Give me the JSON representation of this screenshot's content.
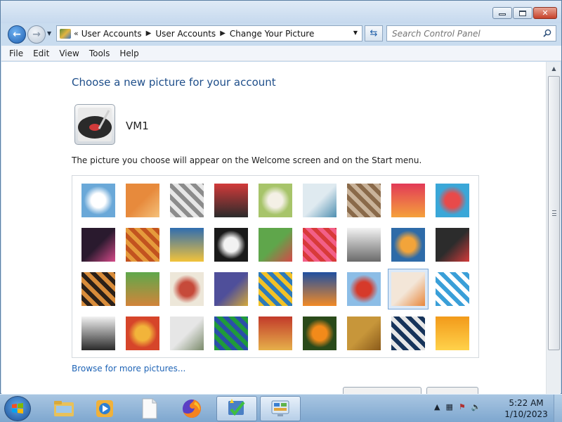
{
  "window": {
    "buttons": {
      "minimize": "minimize",
      "maximize": "maximize",
      "close": "✕"
    }
  },
  "nav": {
    "back_glyph": "←",
    "forward_glyph": "→",
    "breadcrumb_lead": "«",
    "breadcrumb": [
      "User Accounts",
      "User Accounts",
      "Change Your Picture"
    ],
    "search_placeholder": "Search Control Panel"
  },
  "menu": [
    "File",
    "Edit",
    "View",
    "Tools",
    "Help"
  ],
  "main": {
    "heading": "Choose a new picture for your account",
    "account_name": "VM1",
    "description": "The picture you choose will appear on the Welcome screen and on the Start menu.",
    "browse_link": "Browse for more pictures...",
    "selected_picture_index": 25,
    "pictures": [
      {
        "name": "roller-coaster",
        "colors": [
          "#6aa8d8",
          "#ffffff"
        ]
      },
      {
        "name": "starfish",
        "colors": [
          "#e78a3c",
          "#f5c27c"
        ]
      },
      {
        "name": "robot",
        "colors": [
          "#e7e7e7",
          "#8c8c8c"
        ]
      },
      {
        "name": "record-player",
        "colors": [
          "#d23a3a",
          "#2b2b2b"
        ]
      },
      {
        "name": "lucky-cat",
        "colors": [
          "#a7c46a",
          "#f4f0e6"
        ]
      },
      {
        "name": "gyroscope",
        "colors": [
          "#dfeaf0",
          "#4f8fb0"
        ]
      },
      {
        "name": "kitten",
        "colors": [
          "#c9b39a",
          "#8a6a4a"
        ]
      },
      {
        "name": "flower",
        "colors": [
          "#e23a57",
          "#f5a13c"
        ]
      },
      {
        "name": "pinwheel",
        "colors": [
          "#3aa7d8",
          "#e84a4a"
        ]
      },
      {
        "name": "bowling-ball",
        "colors": [
          "#2a1a2e",
          "#d64a8a"
        ]
      },
      {
        "name": "fabric",
        "colors": [
          "#c2531f",
          "#e59a3c"
        ]
      },
      {
        "name": "leaf",
        "colors": [
          "#2f6db0",
          "#f2c33a"
        ]
      },
      {
        "name": "dog",
        "colors": [
          "#1a1a1a",
          "#f2f2f2"
        ]
      },
      {
        "name": "crayons",
        "colors": [
          "#5fa64b",
          "#d64848"
        ]
      },
      {
        "name": "star",
        "colors": [
          "#f25f88",
          "#d83a3a"
        ]
      },
      {
        "name": "jacks",
        "colors": [
          "#f2f2f2",
          "#6a6a6a"
        ]
      },
      {
        "name": "stairs",
        "colors": [
          "#2e6ba8",
          "#f2a43a"
        ]
      },
      {
        "name": "paper-crane",
        "colors": [
          "#2c2c2c",
          "#d43a3a"
        ]
      },
      {
        "name": "guitar",
        "colors": [
          "#d88c3a",
          "#2b2018"
        ]
      },
      {
        "name": "pomeranian",
        "colors": [
          "#5fa84b",
          "#d2843a"
        ]
      },
      {
        "name": "toy-robot",
        "colors": [
          "#ede7d9",
          "#c64a3a"
        ]
      },
      {
        "name": "textile",
        "colors": [
          "#4f4f9a",
          "#d4a93a"
        ]
      },
      {
        "name": "sunflower",
        "colors": [
          "#f2c226",
          "#2e7ab8"
        ]
      },
      {
        "name": "fish",
        "colors": [
          "#1f4fa0",
          "#f28a26"
        ]
      },
      {
        "name": "balloon",
        "colors": [
          "#8cbde6",
          "#d63a2a"
        ]
      },
      {
        "name": "egg-doll",
        "colors": [
          "#f3e6d8",
          "#e8863a"
        ]
      },
      {
        "name": "sailboat",
        "colors": [
          "#3a9fd8",
          "#ffffff"
        ]
      },
      {
        "name": "soccer-ball",
        "colors": [
          "#f2f2f2",
          "#2a2a2a"
        ]
      },
      {
        "name": "striped-fabric",
        "colors": [
          "#d6452a",
          "#f2b43a"
        ]
      },
      {
        "name": "marbles",
        "colors": [
          "#e6e6e6",
          "#7a8a6a"
        ]
      },
      {
        "name": "window",
        "colors": [
          "#1f9b3a",
          "#2a4fa8"
        ]
      },
      {
        "name": "woven-cloth",
        "colors": [
          "#c23a2a",
          "#e6b04a"
        ]
      },
      {
        "name": "butterfly",
        "colors": [
          "#2a4a1a",
          "#f28a1a"
        ]
      },
      {
        "name": "wicker",
        "colors": [
          "#c7963a",
          "#8a5a1a"
        ]
      },
      {
        "name": "lighthouse",
        "colors": [
          "#16335a",
          "#e6e6e6"
        ]
      },
      {
        "name": "orange-flower",
        "colors": [
          "#f29a1a",
          "#ffd24a"
        ]
      }
    ]
  },
  "taskbar": {
    "clock_time": "5:22 AM",
    "clock_date": "1/10/2023",
    "items": [
      "explorer",
      "media-player",
      "blank-document",
      "firefox",
      "action-center-app",
      "control-panel"
    ]
  }
}
